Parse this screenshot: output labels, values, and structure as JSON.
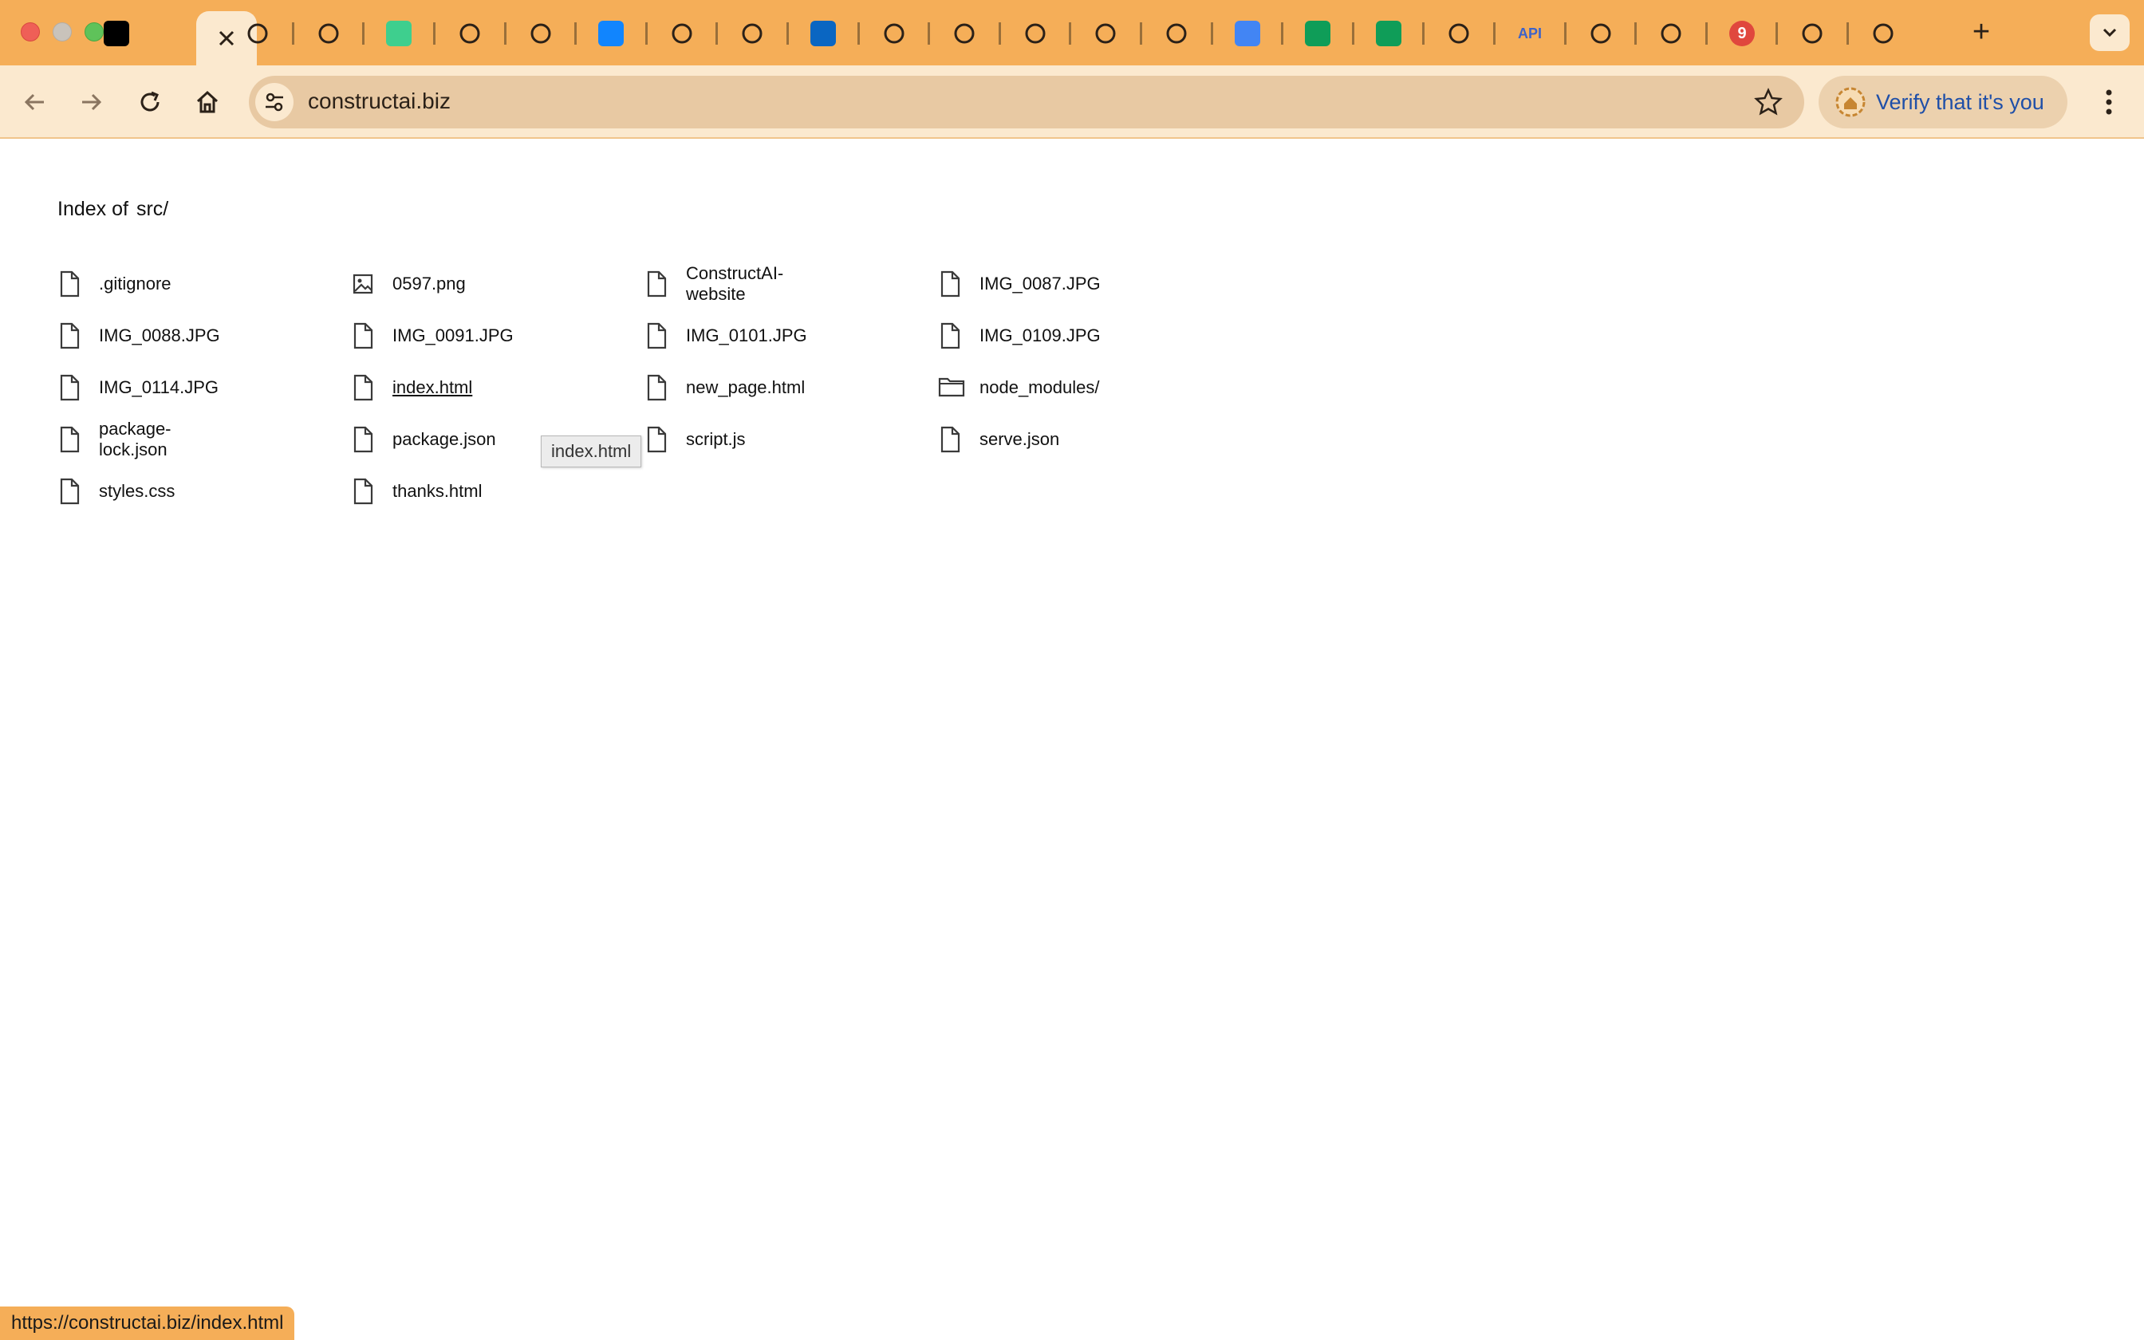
{
  "browser": {
    "tabs": [
      {
        "icon": "notion-check-icon",
        "color": "#000000"
      },
      {
        "icon": "close-icon",
        "active": true
      },
      {
        "icon": "workflow-icon"
      },
      {
        "icon": "workflow-icon"
      },
      {
        "icon": "supabase-icon",
        "color": "#3ecf8e"
      },
      {
        "icon": "wave-icon"
      },
      {
        "icon": "pause-app-icon"
      },
      {
        "icon": "bluesky-icon",
        "color": "#1185fe"
      },
      {
        "icon": "openai-icon"
      },
      {
        "icon": "perplexity-icon"
      },
      {
        "icon": "linkedin-icon",
        "color": "#0a66c2"
      },
      {
        "icon": "anthropic-icon"
      },
      {
        "icon": "google-drive-icon"
      },
      {
        "icon": "hexagon-icon"
      },
      {
        "icon": "hexagon-icon"
      },
      {
        "icon": "google-drive-icon"
      },
      {
        "icon": "google-docs-icon",
        "color": "#4285f4"
      },
      {
        "icon": "google-sheets-icon",
        "color": "#0f9d58"
      },
      {
        "icon": "google-sheets-icon",
        "color": "#0f9d58"
      },
      {
        "icon": "bars-chart-icon"
      },
      {
        "icon": "api-icon",
        "text": "API"
      },
      {
        "icon": "linear-icon"
      },
      {
        "icon": "gmail-icon"
      },
      {
        "icon": "badge-icon",
        "text": "9"
      },
      {
        "icon": "chrome-icon"
      },
      {
        "icon": "github-icon"
      }
    ],
    "new_tab_symbol": "+",
    "address": "constructai.biz",
    "verify_label": "Verify that it's you",
    "status_url": "https://constructai.biz/index.html"
  },
  "page": {
    "heading_prefix": "Index of",
    "heading_path": "src/",
    "tooltip": "index.html",
    "entries": [
      {
        "name": ".gitignore",
        "type": "file"
      },
      {
        "name": "0597.png",
        "type": "image"
      },
      {
        "name": "ConstructAI-website",
        "type": "file"
      },
      {
        "name": "IMG_0087.JPG",
        "type": "file"
      },
      {
        "name": "IMG_0088.JPG",
        "type": "file"
      },
      {
        "name": "IMG_0091.JPG",
        "type": "file"
      },
      {
        "name": "IMG_0101.JPG",
        "type": "file"
      },
      {
        "name": "IMG_0109.JPG",
        "type": "file"
      },
      {
        "name": "IMG_0114.JPG",
        "type": "file"
      },
      {
        "name": "index.html",
        "type": "file",
        "hover": true
      },
      {
        "name": "new_page.html",
        "type": "file"
      },
      {
        "name": "node_modules/",
        "type": "folder"
      },
      {
        "name": "package-lock.json",
        "type": "file"
      },
      {
        "name": "package.json",
        "type": "file"
      },
      {
        "name": "script.js",
        "type": "file"
      },
      {
        "name": "serve.json",
        "type": "file"
      },
      {
        "name": "styles.css",
        "type": "file"
      },
      {
        "name": "thanks.html",
        "type": "file"
      }
    ]
  }
}
